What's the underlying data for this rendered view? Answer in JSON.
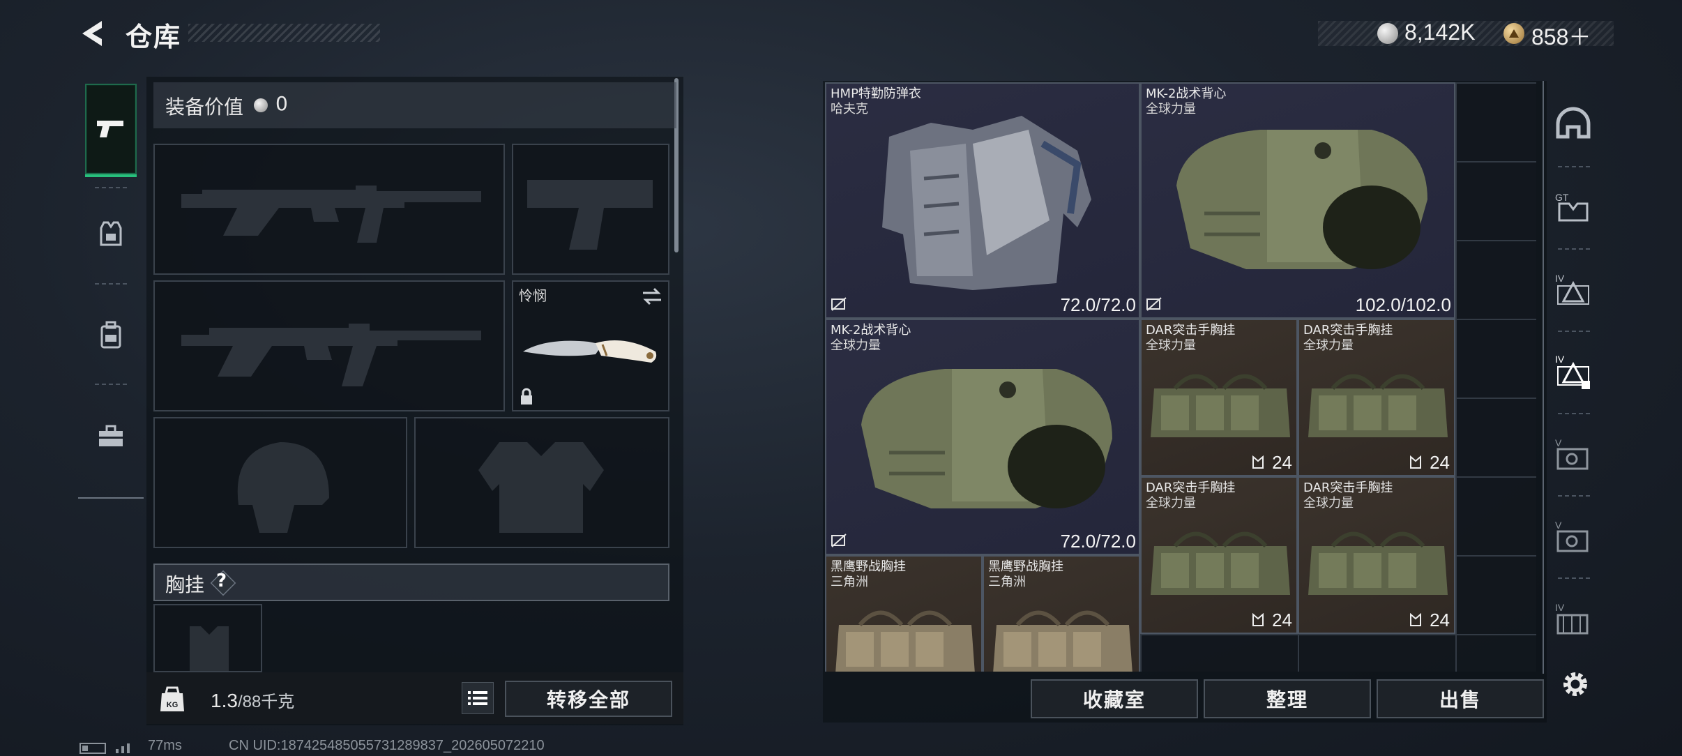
{
  "header": {
    "title": "仓库",
    "silver_amount": "8,142K",
    "gold_amount": "858＋"
  },
  "left_nav": {
    "items": [
      {
        "icon": "pistol-icon",
        "active": true
      },
      {
        "icon": "armor-vest-icon",
        "active": false
      },
      {
        "icon": "backpack-icon",
        "active": false
      },
      {
        "icon": "toolbox-icon",
        "active": false
      }
    ]
  },
  "loadout": {
    "value_label": "装备价值",
    "value": "0",
    "melee_slot_name": "怜悯",
    "chest_rig_label": "胸挂",
    "help_symbol": "?",
    "weight_current": "1.3",
    "weight_max": "/88千克",
    "weight_badge": "KG",
    "transfer_all_label": "转移全部"
  },
  "stash": {
    "items": [
      {
        "name": "HMP特勤防弹衣",
        "brand": "哈夫克",
        "durability": "72.0/72.0",
        "kind": "armor"
      },
      {
        "name": "MK-2战术背心",
        "brand": "全球力量",
        "durability": "102.0/102.0",
        "kind": "armor"
      },
      {
        "name": "MK-2战术背心",
        "brand": "全球力量",
        "durability": "72.0/72.0",
        "kind": "armor"
      },
      {
        "name": "DAR突击手胸挂",
        "brand": "全球力量",
        "count": "24",
        "kind": "rig"
      },
      {
        "name": "DAR突击手胸挂",
        "brand": "全球力量",
        "count": "24",
        "kind": "rig"
      },
      {
        "name": "DAR突击手胸挂",
        "brand": "全球力量",
        "count": "24",
        "kind": "rig"
      },
      {
        "name": "DAR突击手胸挂",
        "brand": "全球力量",
        "count": "24",
        "kind": "rig"
      },
      {
        "name": "黑鹰野战胸挂",
        "brand": "三角洲",
        "kind": "rig"
      },
      {
        "name": "黑鹰野战胸挂",
        "brand": "三角洲",
        "kind": "rig"
      }
    ],
    "rail": [
      {
        "icon": "helmet-filter-icon"
      },
      {
        "icon": "armor-tier-6-icon",
        "label": "GT"
      },
      {
        "icon": "armor-tier-4-icon",
        "label": "IV"
      },
      {
        "icon": "armor-tier-4-locked-icon",
        "label": "IV"
      },
      {
        "icon": "armor-tier-5-icon",
        "label": "V"
      },
      {
        "icon": "armor-tier-5-alt-icon",
        "label": "V"
      },
      {
        "icon": "armor-tier-4-rig-icon",
        "label": "IV"
      }
    ],
    "buttons": {
      "collection": "收藏室",
      "sort": "整理",
      "sell": "出售"
    }
  },
  "status_bar": {
    "ping": "77ms",
    "uid": "CN UID:18742548505573128983​7_202605072210"
  },
  "colors": {
    "accent_green": "#27c07c",
    "armor_tile": "#2b2d42",
    "rig_tile": "#3b332c"
  }
}
